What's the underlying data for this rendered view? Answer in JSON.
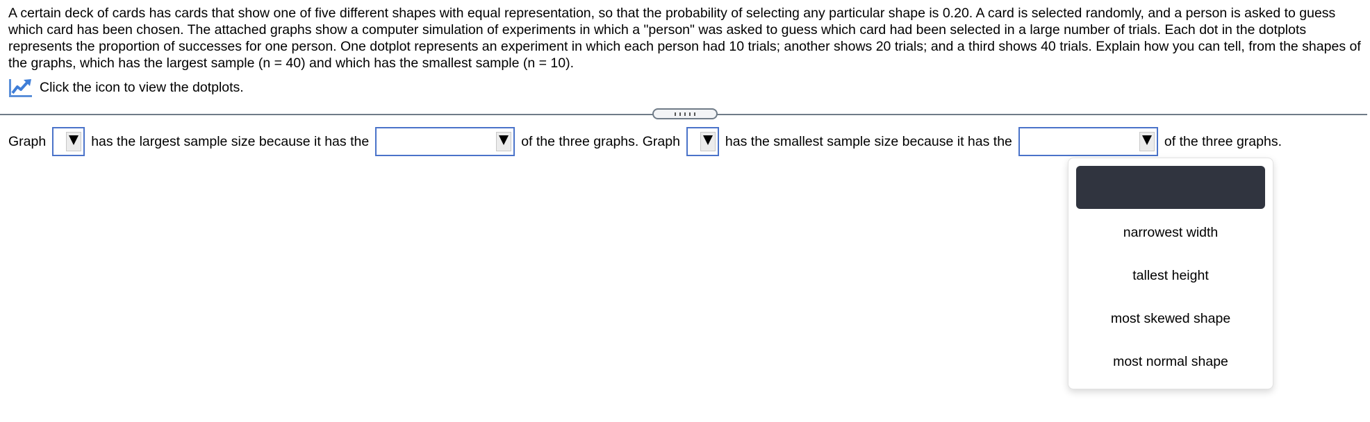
{
  "question": {
    "text": "A certain deck of cards has cards that show one of five different shapes with equal representation, so that the probability of selecting any particular shape is 0.20. A card is selected randomly, and a person is asked to guess which card has been chosen. The attached graphs show a computer simulation of experiments in which a \"person\" was asked to guess which card had been selected in a large number of trials. Each dot in the dotplots represents the proportion of successes for one person. One dotplot represents an experiment in which each person had 10 trials; another shows 20 trials; and a third shows 40 trials. Explain how you can tell, from the shapes of the graphs, which has the largest sample (n = 40) and which has the smallest sample (n = 10).",
    "icon_link_label": "Click the icon to view the dotplots.",
    "icon": "chart-line-icon",
    "accent_color": "#4a73c9"
  },
  "answer": {
    "part1": "Graph",
    "part2": "has the largest sample size because it has the",
    "part3": "of the three graphs. Graph",
    "part4": "has the smallest sample size because it has the",
    "part5": "of the three graphs.",
    "dropdowns": {
      "graph_largest": "",
      "reason_largest": "",
      "graph_smallest": "",
      "reason_smallest": ""
    }
  },
  "open_menu": {
    "selected": "",
    "options": [
      "narrowest width",
      "tallest height",
      "most skewed shape",
      "most normal shape"
    ]
  }
}
